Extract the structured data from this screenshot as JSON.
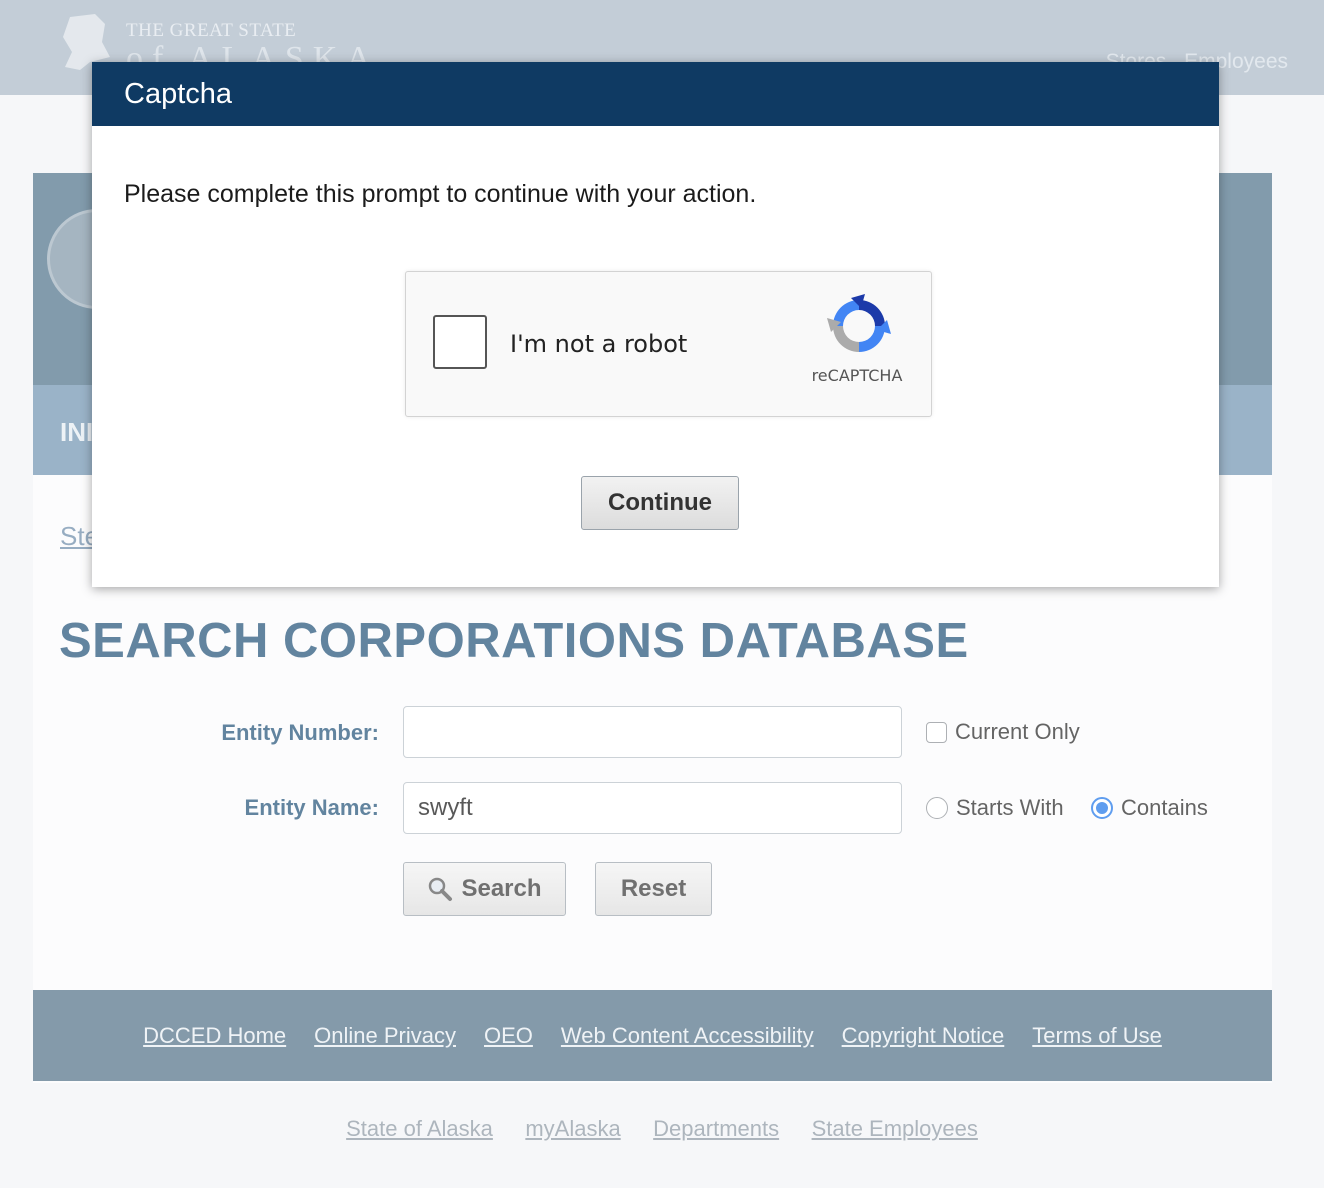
{
  "header": {
    "brand_line1": "THE GREAT STATE",
    "brand_line2": "of ALASKA",
    "top_links": [
      "Stores",
      "Employees"
    ]
  },
  "hero": {
    "sub_text": "INI"
  },
  "breadcrumb": {
    "link": "Ste"
  },
  "page_title": "SEARCH CORPORATIONS DATABASE",
  "form": {
    "entity_number_label": "Entity Number:",
    "entity_number_value": "",
    "current_only_label": "Current Only",
    "current_only_checked": false,
    "entity_name_label": "Entity Name:",
    "entity_name_value": "swyft",
    "starts_with_label": "Starts With",
    "contains_label": "Contains",
    "match_mode_selected": "Contains",
    "search_button": "Search",
    "reset_button": "Reset"
  },
  "footer": {
    "links": [
      "DCCED Home",
      "Online Privacy",
      "OEO",
      "Web Content Accessibility",
      "Copyright Notice",
      "Terms of Use"
    ]
  },
  "bottom": {
    "links": [
      "State of Alaska",
      "myAlaska",
      "Departments",
      "State Employees"
    ]
  },
  "modal": {
    "title": "Captcha",
    "message": "Please complete this prompt to continue with your action.",
    "recaptcha_label": "I'm not a robot",
    "recaptcha_brand": "reCAPTCHA",
    "continue_button": "Continue"
  },
  "colors": {
    "modal_header": "#0f3a63",
    "title_blue": "#1f4f76",
    "footer_band": "#4f6f86",
    "radio_selected": "#1a73e8"
  }
}
